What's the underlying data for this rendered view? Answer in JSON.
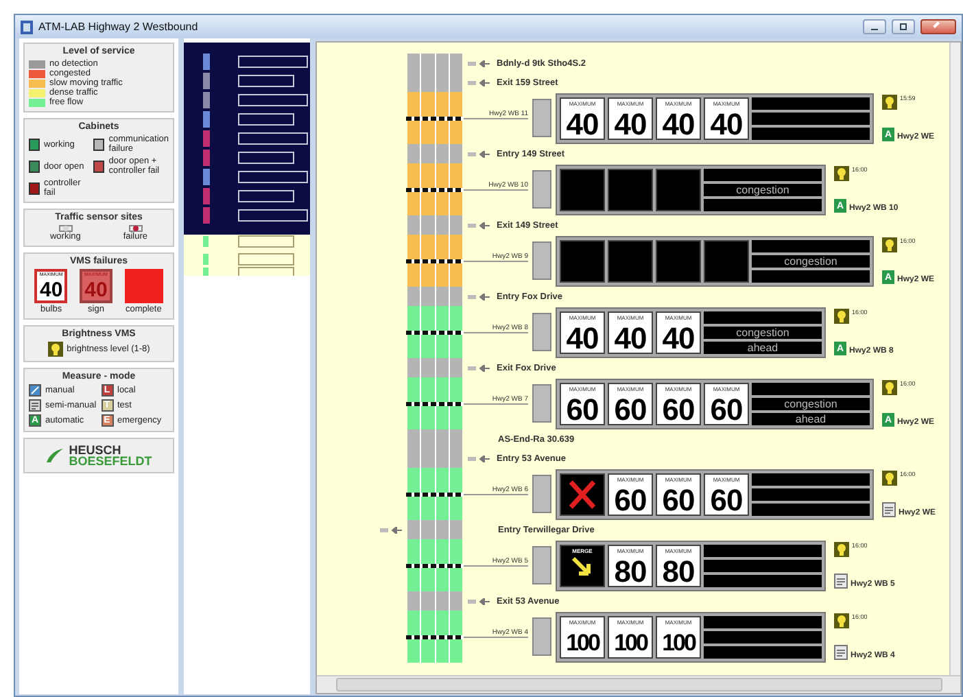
{
  "window": {
    "title": "ATM-LAB Highway 2 Westbound"
  },
  "legend": [
    {
      "title": "Level of service",
      "kind": "swatches",
      "items": [
        {
          "label": "no detection",
          "color": "#9a9a9a"
        },
        {
          "label": "congested",
          "color": "#f05a3c"
        },
        {
          "label": "slow moving traffic",
          "color": "#f8bc50"
        },
        {
          "label": "dense traffic",
          "color": "#f4f070"
        },
        {
          "label": "free flow",
          "color": "#74f094"
        }
      ]
    },
    {
      "title": "Cabinets",
      "kind": "cabinets",
      "items": [
        {
          "label": "working",
          "color": "#2a9a5a"
        },
        {
          "label": "communication failure",
          "color": "#b8b8b8"
        },
        {
          "label": "door open",
          "color": "#3a8a5a"
        },
        {
          "label": "door open + controller fail",
          "color": "#c04848"
        },
        {
          "label": "controller fail",
          "color": "#a01818"
        }
      ]
    },
    {
      "title": "Traffic sensor sites",
      "kind": "sensors",
      "items": [
        {
          "label": "working",
          "color": "#d8d8d8"
        },
        {
          "label": "failure",
          "color": "#c02040"
        }
      ]
    },
    {
      "title": "VMS failures",
      "kind": "vms",
      "items": [
        {
          "label": "bulbs",
          "kind": "bulbs",
          "header": "MAXIMUM",
          "value": "40"
        },
        {
          "label": "sign",
          "kind": "sign",
          "header": "MAXIMUM",
          "value": "40"
        },
        {
          "label": "complete",
          "kind": "complete"
        }
      ]
    },
    {
      "title": "Brightness VMS",
      "kind": "brightness",
      "items": [
        {
          "label": "brightness level (1-8)"
        }
      ]
    },
    {
      "title": "Measure - mode",
      "kind": "modes",
      "items": [
        {
          "label": "manual",
          "kind": "manual",
          "color": "#4a8ac8"
        },
        {
          "label": "local",
          "kind": "letter",
          "glyph": "L",
          "color": "#c04040"
        },
        {
          "label": "semi-manual",
          "kind": "semi-manual",
          "color": "#d8d8d8"
        },
        {
          "label": "test",
          "kind": "letter",
          "glyph": "T",
          "color": "#d8cfa0"
        },
        {
          "label": "automatic",
          "kind": "letter",
          "glyph": "A",
          "color": "#2a9a4a"
        },
        {
          "label": "emergency",
          "kind": "letter",
          "glyph": "E",
          "color": "#d88060"
        }
      ]
    }
  ],
  "logo": {
    "line_1": "HEUSCH",
    "line_2": "BOESEFELDT"
  },
  "road": {
    "entries": [
      {
        "kind": "ramp",
        "text": "Bdnly-d 9tk Stho4S.2"
      },
      {
        "kind": "ramp",
        "text": "Exit 159 Street"
      },
      {
        "kind": "station",
        "id": "Hwy2 WB 11",
        "color": "#f8bc50",
        "panels": [
          {
            "kind": "speed",
            "header": "MAXIMUM",
            "value": "40"
          },
          {
            "kind": "speed",
            "header": "MAXIMUM",
            "value": "40"
          },
          {
            "kind": "speed",
            "header": "MAXIMUM",
            "value": "40"
          },
          {
            "kind": "speed",
            "header": "MAXIMUM",
            "value": "40"
          }
        ],
        "time": "15:59",
        "mode": {
          "kind": "automatic",
          "glyph": "A"
        },
        "label": "Hwy2 WE"
      },
      {
        "kind": "ramp",
        "text": "Entry 149 Street"
      },
      {
        "kind": "station",
        "id": "Hwy2 WB 10",
        "color": "#f8bc50",
        "panels": [
          {
            "kind": "blank"
          },
          {
            "kind": "blank"
          },
          {
            "kind": "blank"
          }
        ],
        "message": [
          "congestion"
        ],
        "time": "16:00",
        "mode": {
          "kind": "automatic",
          "glyph": "A"
        },
        "label": "Hwy2 WB 10"
      },
      {
        "kind": "ramp",
        "text": "Exit 149 Street"
      },
      {
        "kind": "station",
        "id": "Hwy2 WB 9",
        "color": "#f8bc50",
        "panels": [
          {
            "kind": "blank"
          },
          {
            "kind": "blank"
          },
          {
            "kind": "blank"
          },
          {
            "kind": "blank"
          }
        ],
        "message": [
          "congestion"
        ],
        "time": "16:00",
        "mode": {
          "kind": "automatic",
          "glyph": "A"
        },
        "label": "Hwy2 WE"
      },
      {
        "kind": "ramp",
        "text": "Entry Fox Drive"
      },
      {
        "kind": "station",
        "id": "Hwy2 WB 8",
        "color": "#74f094",
        "panels": [
          {
            "kind": "speed",
            "header": "MAXIMUM",
            "value": "40"
          },
          {
            "kind": "speed",
            "header": "MAXIMUM",
            "value": "40"
          },
          {
            "kind": "speed",
            "header": "MAXIMUM",
            "value": "40"
          }
        ],
        "message": [
          "congestion",
          "ahead"
        ],
        "time": "16:00",
        "mode": {
          "kind": "automatic",
          "glyph": "A"
        },
        "label": "Hwy2 WB 8"
      },
      {
        "kind": "ramp",
        "text": "Exit Fox Drive"
      },
      {
        "kind": "station",
        "id": "Hwy2 WB 7",
        "color": "#74f094",
        "panels": [
          {
            "kind": "speed",
            "header": "MAXIMUM",
            "value": "60"
          },
          {
            "kind": "speed",
            "header": "MAXIMUM",
            "value": "60"
          },
          {
            "kind": "speed",
            "header": "MAXIMUM",
            "value": "60"
          },
          {
            "kind": "speed",
            "header": "MAXIMUM",
            "value": "60"
          }
        ],
        "message": [
          "congestion",
          "ahead"
        ],
        "time": "16:00",
        "mode": {
          "kind": "automatic",
          "glyph": "A"
        },
        "label": "Hwy2 WE"
      },
      {
        "kind": "marker",
        "text": "AS-End-Ra 30.639"
      },
      {
        "kind": "ramp",
        "text": "Entry 53 Avenue"
      },
      {
        "kind": "station",
        "id": "Hwy2 WB 6",
        "color": "#74f094",
        "panels": [
          {
            "kind": "cross"
          },
          {
            "kind": "speed",
            "header": "MAXIMUM",
            "value": "60"
          },
          {
            "kind": "speed",
            "header": "MAXIMUM",
            "value": "60"
          },
          {
            "kind": "speed",
            "header": "MAXIMUM",
            "value": "60"
          }
        ],
        "time": "16:00",
        "mode": {
          "kind": "semi-manual"
        },
        "label": "Hwy2 WE"
      },
      {
        "kind": "ramp-left",
        "text": "Entry Terwillegar Drive"
      },
      {
        "kind": "station",
        "id": "Hwy2 WB 5",
        "color": "#74f094",
        "panels": [
          {
            "kind": "merge",
            "header": "MERGE"
          },
          {
            "kind": "speed",
            "header": "MAXIMUM",
            "value": "80"
          },
          {
            "kind": "speed",
            "header": "MAXIMUM",
            "value": "80"
          }
        ],
        "time": "16:00",
        "mode": {
          "kind": "semi-manual"
        },
        "label": "Hwy2 WB 5"
      },
      {
        "kind": "ramp",
        "text": "Exit 53 Avenue"
      },
      {
        "kind": "station",
        "id": "Hwy2 WB 4",
        "color": "#74f094",
        "panels": [
          {
            "kind": "speed",
            "header": "MAXIMUM",
            "value": "100"
          },
          {
            "kind": "speed",
            "header": "MAXIMUM",
            "value": "100"
          },
          {
            "kind": "speed",
            "header": "MAXIMUM",
            "value": "100"
          }
        ],
        "time": "16:00",
        "mode": {
          "kind": "semi-manual"
        },
        "label": "Hwy2 WB 4"
      }
    ]
  }
}
